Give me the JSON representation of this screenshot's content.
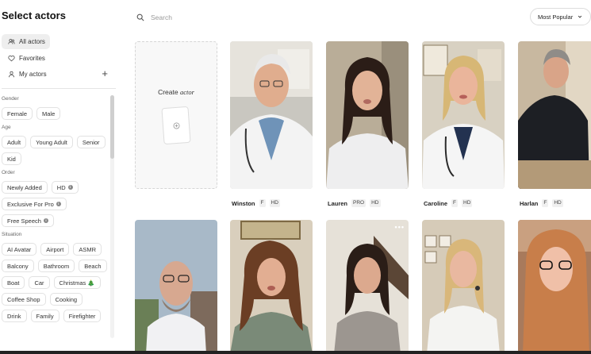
{
  "sidebar": {
    "title": "Select actors",
    "nav": [
      {
        "label": "All actors",
        "icon": "people-icon",
        "active": true
      },
      {
        "label": "Favorites",
        "icon": "heart-icon",
        "active": false
      },
      {
        "label": "My actors",
        "icon": "person-icon",
        "active": false
      }
    ],
    "add_label": "+",
    "filters": {
      "gender": {
        "label": "Gender",
        "options": [
          "Female",
          "Male"
        ]
      },
      "age": {
        "label": "Age",
        "options": [
          "Adult",
          "Young Adult",
          "Senior",
          "Kid"
        ]
      },
      "order": {
        "label": "Order",
        "options": [
          "Newly Added",
          "HD",
          "Exclusive For Pro",
          "Free Speech"
        ]
      },
      "situation": {
        "label": "Situation",
        "options": [
          "AI Avatar",
          "Airport",
          "ASMR",
          "Balcony",
          "Bathroom",
          "Beach",
          "Boat",
          "Car",
          "Christmas 🎄",
          "Coffee Shop",
          "Cooking",
          "Drink",
          "Family",
          "Firefighter"
        ]
      }
    }
  },
  "header": {
    "search_placeholder": "Search",
    "sort_label": "Most Popular"
  },
  "create_card": {
    "label_prefix": "Create ",
    "label_italic": "actor"
  },
  "actors": [
    {
      "name": "Winston",
      "tags": [
        "F",
        "HD"
      ]
    },
    {
      "name": "Lauren",
      "tags": [
        "PRO",
        "HD"
      ]
    },
    {
      "name": "Caroline",
      "tags": [
        "F",
        "HD"
      ]
    },
    {
      "name": "Harlan",
      "tags": [
        "F",
        "HD"
      ]
    }
  ],
  "card_more_label": "•••",
  "colors": {
    "accent_bg": "#eeeeee",
    "chip_border": "#e2e2e2",
    "text": "#222222"
  }
}
